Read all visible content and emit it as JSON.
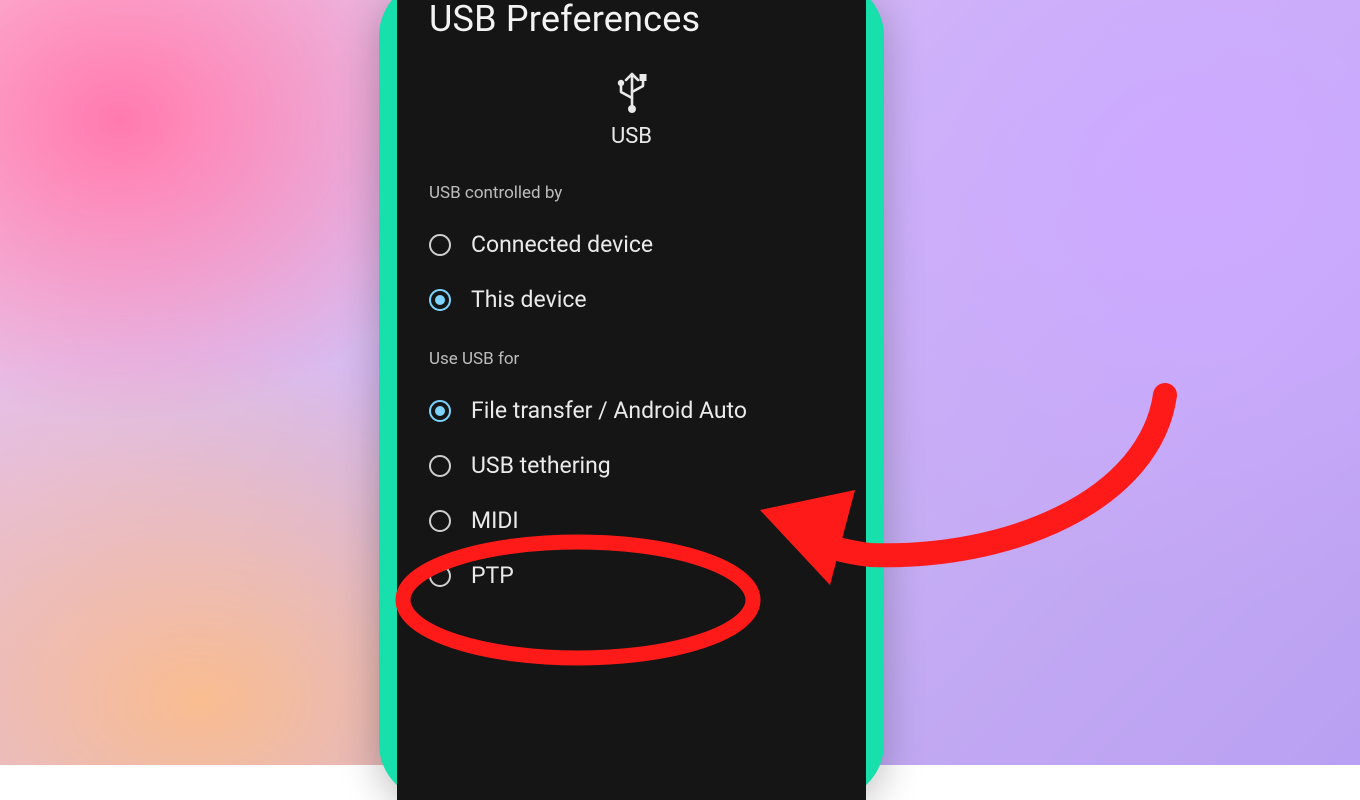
{
  "title": "USB Preferences",
  "usb_icon_label": "USB",
  "sections": {
    "controlled_by": {
      "header": "USB controlled by",
      "options": [
        {
          "label": "Connected device",
          "selected": false
        },
        {
          "label": "This device",
          "selected": true
        }
      ]
    },
    "use_for": {
      "header": "Use USB for",
      "options": [
        {
          "label": "File transfer / Android Auto",
          "selected": true
        },
        {
          "label": "USB tethering",
          "selected": false
        },
        {
          "label": "MIDI",
          "selected": false
        },
        {
          "label": "PTP",
          "selected": false
        }
      ]
    }
  },
  "annotation": {
    "target_option": "USB tethering",
    "color": "#ff1a1a"
  }
}
